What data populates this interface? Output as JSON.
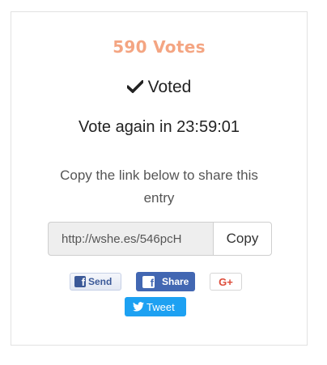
{
  "entry": {
    "votes_label": "590 Votes",
    "voted_label": "Voted",
    "vote_again_label": "Vote again in 23:59:01",
    "share_text": "Copy the link below to share this entry",
    "share_url": "http://wshe.es/546pcH",
    "copy_label": "Copy"
  },
  "social": {
    "send_label": "Send",
    "share_label": "Share",
    "gplus_label": "G+",
    "tweet_label": "Tweet"
  },
  "colors": {
    "votes": "#f4a582",
    "facebook": "#4267b2",
    "twitter": "#1da1f2",
    "google": "#dd4b39"
  },
  "icons": {
    "voted": "check-icon",
    "send": "facebook-icon",
    "share": "facebook-icon",
    "tweet": "twitter-bird-icon"
  }
}
